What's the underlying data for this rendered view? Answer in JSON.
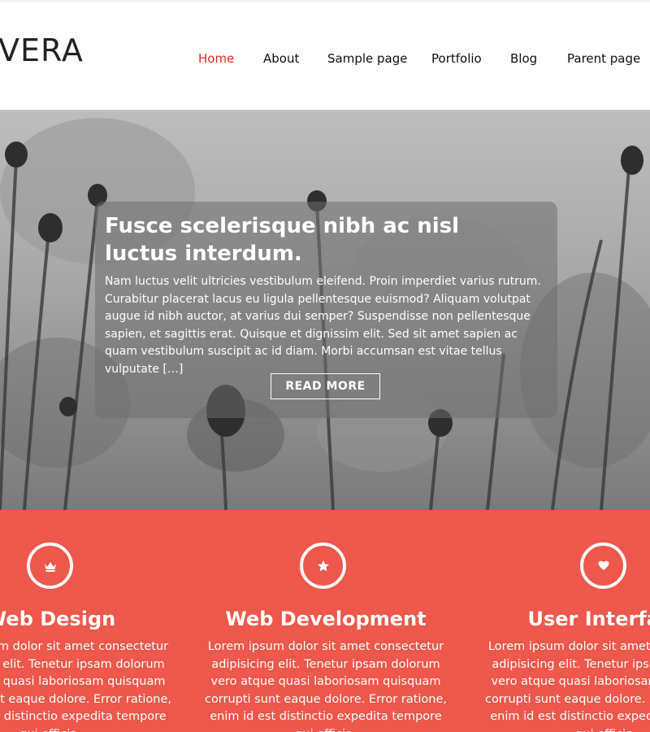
{
  "header": {
    "logo": "VERA",
    "nav": [
      {
        "label": "Home",
        "active": true
      },
      {
        "label": "About",
        "active": false
      },
      {
        "label": "Sample page",
        "active": false
      },
      {
        "label": "Portfolio",
        "active": false
      },
      {
        "label": "Blog",
        "active": false
      },
      {
        "label": "Parent page",
        "active": false
      }
    ]
  },
  "hero": {
    "title": "Fusce scelerisque nibh ac nisl luctus interdum.",
    "excerpt": "Nam luctus velit ultricies vestibulum eleifend. Proin imperdiet varius rutrum. Curabitur placerat lacus eu ligula pellentesque euismod? Aliquam volutpat augue id nibh auctor, at varius dui semper? Suspendisse non pellentesque sapien, et sagittis erat. Quisque et dignissim elit. Sed sit amet sapien ac quam vestibulum suscipit ac id diam. Morbi accumsan est vitae tellus vulputate […]",
    "button": "READ MORE"
  },
  "services": [
    {
      "icon": "crown-icon",
      "title": "Web Design",
      "text": "Lorem ipsum dolor sit amet consectetur adipisicing elit. Tenetur ipsam dolorum vero atque quasi laboriosam quisquam corrupti sunt eaque dolore. Error ratione, enim id est distinctio expedita tempore qui officia."
    },
    {
      "icon": "star-icon",
      "title": "Web Development",
      "text": "Lorem ipsum dolor sit amet consectetur adipisicing elit. Tenetur ipsam dolorum vero atque quasi laboriosam quisquam corrupti sunt eaque dolore. Error ratione, enim id est distinctio expedita tempore qui officia."
    },
    {
      "icon": "heart-icon",
      "title": "User Interface",
      "text": "Lorem ipsum dolor sit amet consectetur adipisicing elit. Tenetur ipsam dolorum vero atque quasi laboriosam quisquam corrupti sunt eaque dolore. Error ratione, enim id est distinctio expedita tempore qui officia."
    }
  ],
  "colors": {
    "accent": "#e02a1e",
    "services_bg": "#ee574b"
  }
}
